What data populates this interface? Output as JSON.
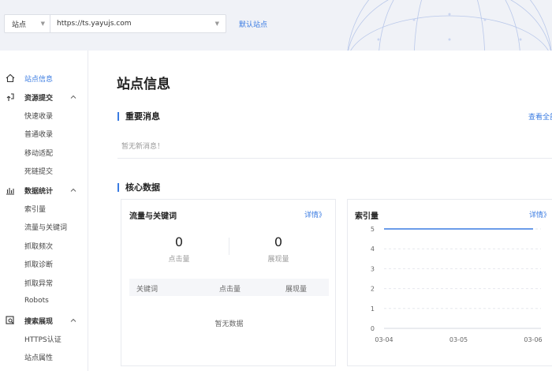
{
  "header": {
    "site_type": "站点",
    "site_url": "https://ts.yayujs.com",
    "default_site": "默认站点"
  },
  "sidebar": {
    "site_info": "站点信息",
    "resource_submit": "资源提交",
    "quick_index": "快速收录",
    "normal_index": "普通收录",
    "mobile_adapt": "移动适配",
    "dead_link": "死链提交",
    "data_stats": "数据统计",
    "index_volume": "索引量",
    "traffic_keywords": "流量与关键词",
    "crawl_freq": "抓取频次",
    "crawl_diag": "抓取诊断",
    "crawl_error": "抓取异常",
    "robots": "Robots",
    "search_display": "搜索展现",
    "https_auth": "HTTPS认证",
    "site_props": "站点属性"
  },
  "main": {
    "title": "站点信息",
    "important_msgs": "重要消息",
    "view_all": "查看全部",
    "no_msgs": "暂无新消息！",
    "core_data": "核心数据",
    "traffic_card": {
      "title": "流量与关键词",
      "detail": "详情》",
      "clicks_value": "0",
      "clicks_label": "点击量",
      "impressions_value": "0",
      "impressions_label": "展现量",
      "col_keyword": "关键词",
      "col_clicks": "点击量",
      "col_impressions": "展现量",
      "no_data": "暂无数据"
    },
    "index_card": {
      "title": "索引量",
      "detail": "详情》"
    }
  },
  "colors": {
    "accent": "#3a7be2",
    "header_bg": "#f0f2f7"
  },
  "chart_data": {
    "type": "line",
    "x": [
      "03-04",
      "03-05",
      "03-06"
    ],
    "series": [
      {
        "values": [
          5,
          5,
          5
        ]
      }
    ],
    "ylim": [
      0,
      5
    ],
    "yticks": [
      0,
      1,
      2,
      3,
      4,
      5
    ],
    "grid": true
  }
}
